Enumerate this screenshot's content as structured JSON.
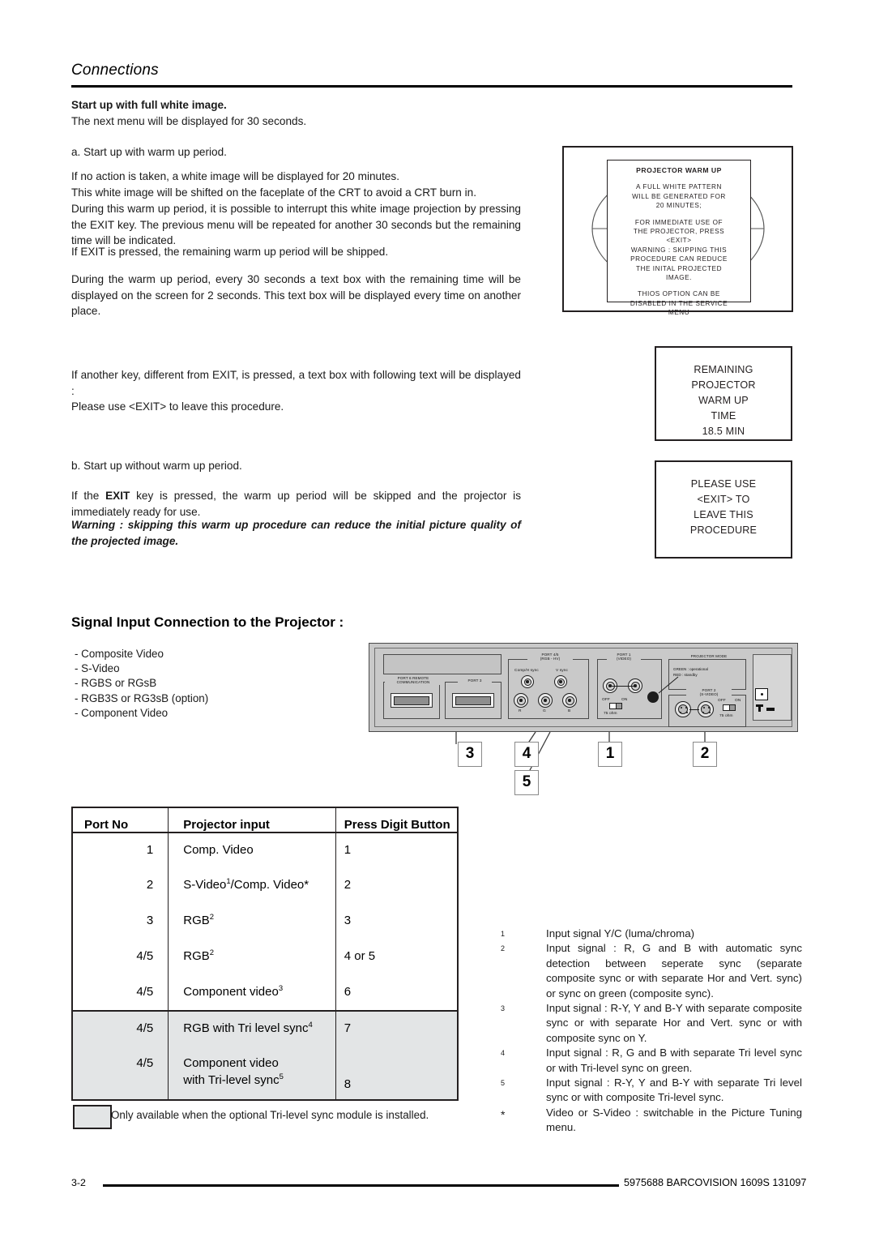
{
  "header": {
    "chapter": "Connections"
  },
  "body": {
    "lead_title": "Start up with full white image.",
    "lead_line": "The next menu will be displayed for 30 seconds.",
    "para_a_title": "a. Start up with warm up period.",
    "para_1": "If no action is taken, a white image will be displayed for 20 minutes.",
    "para_2": "This white image will be shifted on the faceplate of the CRT to avoid a CRT burn in.",
    "para_3": "During this warm up period, it is possible to interrupt this white image projection by pressing the EXIT key.  The previous menu will be repeated for another 30 seconds but the remaining time will be indicated.",
    "para_4": "If EXIT is pressed, the remaining warm up period will be shipped.",
    "para_5": "During the warm up period, every 30 seconds a text box with the remaining time will be displayed on the screen for 2 seconds.  This text box will be displayed  every time on another place.",
    "para_6": "If another key, different from EXIT, is pressed, a text box with following text will be displayed :",
    "para_7": "Please use <EXIT> to leave this procedure.",
    "para_b_title": "b. Start up without warm up period.",
    "para_8_pre": "If the ",
    "para_8_bold": "EXIT",
    "para_8_post": " key is pressed, the warm up period will be skipped and the projector is immediately ready for use.",
    "warning": "Warning : skipping this warm up procedure can reduce the initial picture quality of the projected image."
  },
  "osd_warmup": {
    "title": "PROJECTOR WARM UP",
    "group1": [
      "A FULL WHITE PATTERN",
      "WILL BE GENERATED FOR",
      "20 MINUTES;"
    ],
    "group2": [
      "FOR IMMEDIATE USE OF",
      "THE PROJECTOR, PRESS",
      "<EXIT>",
      "WARNING : SKIPPING THIS",
      "PROCEDURE CAN REDUCE",
      "THE INITAL PROJECTED",
      "IMAGE."
    ],
    "group3": [
      "THIOS OPTION CAN BE",
      "DISABLED IN THE SERVICE",
      "MENU"
    ]
  },
  "osd_remaining": {
    "lines": [
      "REMAINING",
      "PROJECTOR",
      "WARM UP",
      "TIME",
      "18.5 MIN"
    ]
  },
  "osd_please": {
    "lines": [
      "PLEASE USE",
      "<EXIT> TO",
      "LEAVE THIS",
      "PROCEDURE"
    ]
  },
  "signal_section": {
    "heading": "Signal Input Connection to the Projector :",
    "bullets": [
      "- Composite Video",
      "-  S-Video",
      "- RGBS or RGsB",
      "- RGB3S or RG3sB (option)",
      "- Component Video"
    ]
  },
  "panel": {
    "labels": {
      "port6": "PORT 6 REMOTE\nCOMMUNICATION",
      "port6_l1": "PORT 6 REMOTE",
      "port6_l2": "COMMUNICATION",
      "port3": "PORT 3",
      "port45_l1": "PORT 4/5",
      "port45_l2": "(RGB - HV)",
      "comph": "Comp/H sync",
      "vsync": "V sync",
      "r": "R",
      "g": "G",
      "b": "B",
      "port1_l1": "PORT 1",
      "port1_l2": "(VIDEO)",
      "port2_l1": "PORT 2",
      "port2_l2": "(S-VIDEO)",
      "mode": "PROJECTOR MODE",
      "mode_green": "GREEN : operational",
      "mode_red": "RED : standby",
      "off": "OFF",
      "on": "ON",
      "ohm": "75 ohm"
    },
    "callouts": [
      "3",
      "4",
      "5",
      "1",
      "2"
    ]
  },
  "table": {
    "headers": [
      "Port No",
      "Projector input",
      "Press Digit Button"
    ],
    "rows": [
      {
        "port": "1",
        "input": "Comp. Video",
        "input_sup": "",
        "digit": "1",
        "shaded": false
      },
      {
        "port": "2",
        "input_pre": "S-Video",
        "input_sup": "1",
        "input_post": "/Comp. Video*",
        "digit": "2",
        "shaded": false
      },
      {
        "port": "3",
        "input_pre": "RGB",
        "input_sup": "2",
        "input_post": "",
        "digit": "3",
        "shaded": false
      },
      {
        "port": "4/5",
        "input_pre": "RGB",
        "input_sup": "2",
        "input_post": "",
        "digit": "4 or 5",
        "shaded": false
      },
      {
        "port": "4/5",
        "input_pre": "Component video",
        "input_sup": "3",
        "input_post": "",
        "digit": "6",
        "shaded": false
      },
      {
        "port": "4/5",
        "input_pre": "RGB with Tri level sync",
        "input_sup": "4",
        "input_post": "",
        "digit": "7",
        "shaded": true
      },
      {
        "port": "4/5",
        "input_pre": "Component video",
        "input_line2": "with Tri-level sync",
        "input_sup": "5",
        "input_post": "",
        "digit": "8",
        "shaded": true
      }
    ],
    "legend": "Only available when the optional Tri-level sync module is installed."
  },
  "footnotes": [
    {
      "mark": "1",
      "text": "Input signal Y/C (luma/chroma)"
    },
    {
      "mark": "2",
      "text": "Input signal : R, G and B with automatic sync detection between seperate sync (separate composite sync or with separate Hor and Vert. sync) or sync on green (composite sync)."
    },
    {
      "mark": "3",
      "text": "Input signal : R-Y, Y and B-Y with separate composite sync  or with separate Hor and Vert. sync or with composite sync on Y."
    },
    {
      "mark": "4",
      "text": "Input signal : R, G and B with separate Tri level sync or with Tri-level sync on green."
    },
    {
      "mark": "5",
      "text": "Input signal : R-Y, Y and B-Y with separate Tri level sync or with composite Tri-level sync."
    },
    {
      "mark": "*",
      "text": "Video or S-Video : switchable in the Picture Tuning menu."
    }
  ],
  "footer": {
    "page": "3-2",
    "reference": "5975688 BARCOVISION 1609S 131097"
  },
  "colors": {
    "ink": "#231f20",
    "panel_gray": "#c9c9c9",
    "shade_gray": "#e3e5e6"
  }
}
